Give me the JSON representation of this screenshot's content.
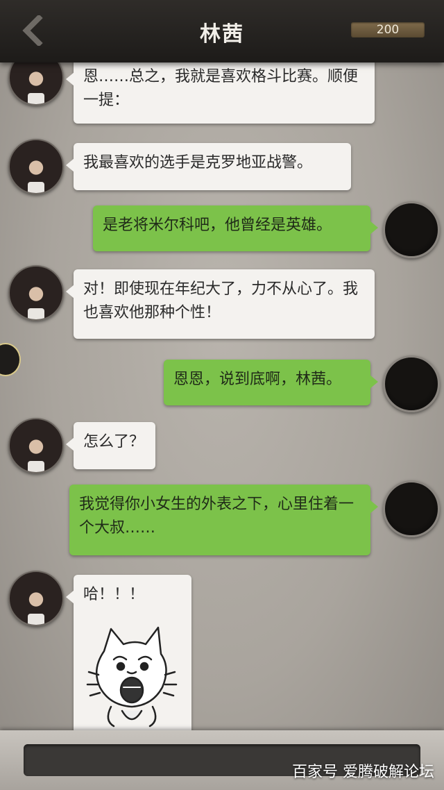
{
  "header": {
    "title": "林茜",
    "coins": "200"
  },
  "messages": [
    {
      "side": "in",
      "text": "恩……总之，我就是喜欢格斗比赛。顺便一提："
    },
    {
      "side": "in",
      "text": "我最喜欢的选手是克罗地亚战警。"
    },
    {
      "side": "out",
      "text": "是老将米尔科吧，他曾经是英雄。"
    },
    {
      "side": "in",
      "text": "对！即使现在年纪大了，力不从心了。我也喜欢他那种个性！"
    },
    {
      "side": "out",
      "text": "恩恩，说到底啊，林茜。"
    },
    {
      "side": "in",
      "text": "怎么了？"
    },
    {
      "side": "out",
      "text": "我觉得你小女生的外表之下，心里住着一个大叔……"
    },
    {
      "side": "in",
      "text": "哈！！！"
    }
  ],
  "watermark": "百家号 爱腾破解论坛",
  "colors": {
    "incoming_bubble": "#f4f2ef",
    "outgoing_bubble": "#7cc24a",
    "header_bg": "#1d1b19",
    "coin_badge": "#6b5a3e"
  },
  "icons": {
    "back": "chevron-left-icon",
    "sticker": "screaming-cat-sticker"
  }
}
